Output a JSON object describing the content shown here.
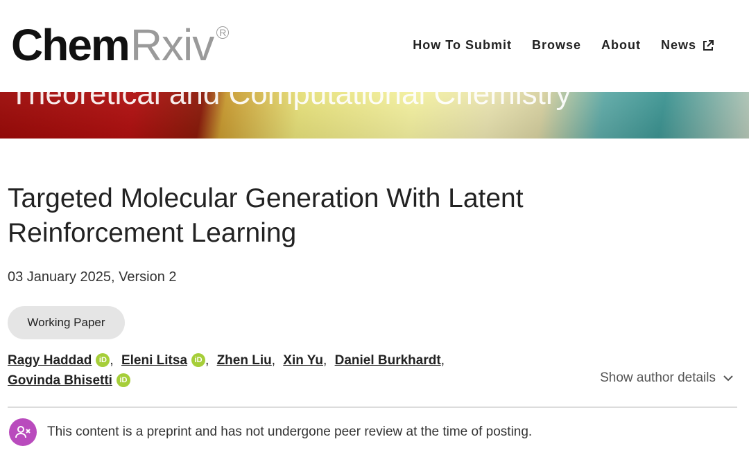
{
  "logo": {
    "chem": "Chem",
    "rxiv": "Rxiv",
    "reg": "R"
  },
  "nav": {
    "items": [
      {
        "label": "How To Submit"
      },
      {
        "label": "Browse"
      },
      {
        "label": "About"
      },
      {
        "label": "News",
        "icon": "external-link-icon"
      }
    ]
  },
  "banner": {
    "category": "Theoretical and Computational Chemistry"
  },
  "paper": {
    "title": "Targeted Molecular Generation With Latent Reinforcement Learning",
    "date_version": "03 January 2025, Version 2",
    "type_badge": "Working Paper"
  },
  "authors": [
    {
      "name": "Ragy Haddad",
      "orcid": true
    },
    {
      "name": "Eleni Litsa",
      "orcid": true
    },
    {
      "name": "Zhen Liu",
      "orcid": false
    },
    {
      "name": "Xin Yu",
      "orcid": false
    },
    {
      "name": "Daniel Burkhardt",
      "orcid": false
    },
    {
      "name": "Govinda Bhisetti",
      "orcid": true
    }
  ],
  "author_details_toggle": "Show author details",
  "notice": {
    "text": "This content is a preprint and has not undergone peer review at the time of posting.",
    "icon": "user-x-icon"
  },
  "colors": {
    "orcid": "#a6ce39",
    "notice_icon_bg": "#b94bbd",
    "badge_bg": "#e5e5e5"
  }
}
